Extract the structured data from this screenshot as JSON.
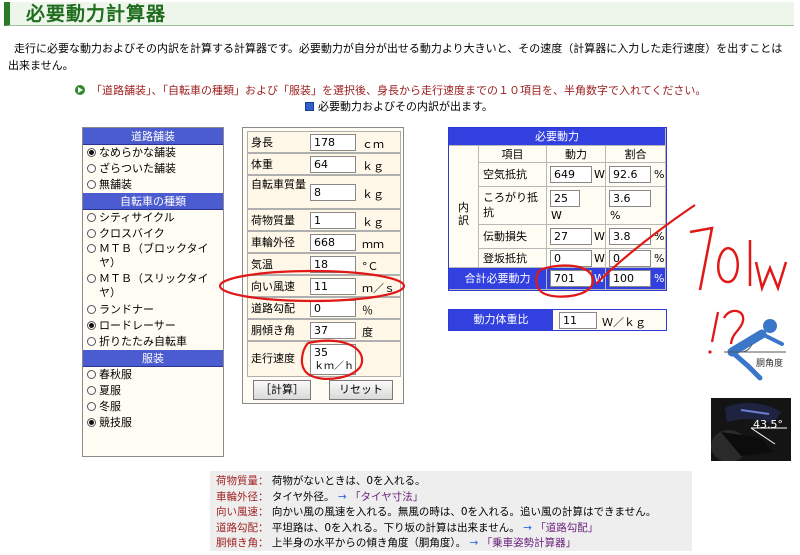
{
  "page": {
    "title": "必要動力計算器",
    "intro": "走行に必要な動力およびその内訳を計算する計算器です。必要動力が自分が出せる動力より大きいと、その速度（計算器に入力した走行速度）を出すことは出来ません。",
    "instruction": "「道路舗装」、「自転車の種類」および「服装」を選択後、身長から走行速度までの１０項目を、半角数字で入れてください。",
    "instruction_note": "必要動力およびその内訳が出ます。"
  },
  "left_panel": {
    "road": {
      "heading": "道路舗装",
      "options": [
        {
          "label": "なめらかな舗装",
          "selected": true
        },
        {
          "label": "ざらついた舗装",
          "selected": false
        },
        {
          "label": "無舗装",
          "selected": false
        }
      ]
    },
    "bike": {
      "heading": "自転車の種類",
      "options": [
        {
          "label": "シティサイクル",
          "selected": false
        },
        {
          "label": "クロスバイク",
          "selected": false
        },
        {
          "label": "ＭＴＢ（ブロックタイヤ）",
          "selected": false
        },
        {
          "label": "ＭＴＢ（スリックタイヤ）",
          "selected": false
        },
        {
          "label": "ランドナー",
          "selected": false
        },
        {
          "label": "ロードレーサー",
          "selected": true
        },
        {
          "label": "折りたたみ自転車",
          "selected": false
        }
      ]
    },
    "clothing": {
      "heading": "服装",
      "options": [
        {
          "label": "春秋服",
          "selected": false
        },
        {
          "label": "夏服",
          "selected": false
        },
        {
          "label": "冬服",
          "selected": false
        },
        {
          "label": "競技服",
          "selected": true
        }
      ]
    }
  },
  "inputs": {
    "height": {
      "label": "身長",
      "value": "178",
      "unit": "ｃｍ"
    },
    "weight": {
      "label": "体重",
      "value": "64",
      "unit": "ｋｇ"
    },
    "bike_mass": {
      "label": "自転車質量",
      "value": "8",
      "unit": "ｋｇ"
    },
    "cargo_mass": {
      "label": "荷物質量",
      "value": "1",
      "unit": "ｋｇ"
    },
    "wheel_circ": {
      "label": "車輪外径",
      "value": "668",
      "unit": "ｍｍ"
    },
    "temperature": {
      "label": "気温",
      "value": "18",
      "unit": "°Ｃ"
    },
    "headwind": {
      "label": "向い風速",
      "value": "11",
      "unit": "ｍ／ｓ"
    },
    "grade": {
      "label": "道路勾配",
      "value": "0",
      "unit": "％"
    },
    "torso_angle": {
      "label": "胴傾き角",
      "value": "37",
      "unit": "度"
    },
    "speed": {
      "label": "走行速度",
      "value": "35",
      "unit": "ｋｍ／ｈ"
    },
    "calc_button": "［計算］",
    "reset_button": "リセット"
  },
  "results": {
    "title": "必要動力",
    "col_item": "項目",
    "col_power": "動力",
    "col_ratio": "割合",
    "breakdown_label": "内訳",
    "rows": [
      {
        "label": "空気抵抗",
        "power": "649",
        "ratio": "92.6"
      },
      {
        "label": "ころがり抵抗",
        "power": "25",
        "ratio": "3.6"
      },
      {
        "label": "伝動損失",
        "power": "27",
        "ratio": "3.8"
      },
      {
        "label": "登坂抵抗",
        "power": "0",
        "ratio": "0"
      }
    ],
    "unit_w": "W",
    "unit_pct": "%",
    "total_label": "合計必要動力",
    "total_power": "701",
    "total_ratio": "100",
    "ratio_label": "動力体重比",
    "ratio_value": "11",
    "ratio_unit": "Ｗ／ｋｇ"
  },
  "notes": [
    {
      "key": "荷物質量：",
      "text": "荷物がないときは、0を入れる。",
      "link": ""
    },
    {
      "key": "車輪外径：",
      "text": "タイヤ外径。",
      "link": "「タイヤ寸法」"
    },
    {
      "key": "向い風速：",
      "text": "向かい風の風速を入れる。無風の時は、0を入れる。追い風の計算はできません。",
      "link": ""
    },
    {
      "key": "道路勾配：",
      "text": "平坦路は、0を入れる。下り坂の計算は出来ません。",
      "link": "「道路勾配」"
    },
    {
      "key": "胴傾き角：",
      "text": "上半身の水平からの傾き角度（胴角度）。",
      "link": "「乗車姿勢計算器」"
    }
  ],
  "arrow_glyph": "→",
  "annotations": {
    "handwritten": "701w",
    "handwritten_question": "!?",
    "figure_label": "胴角度",
    "photo_angle": "43.5°"
  },
  "colors": {
    "title_green": "#1f6e1f",
    "section_blue": "#4b5bd0",
    "table_blue": "#3240e0",
    "ink_red": "#e01818",
    "note_key": "#a12323"
  }
}
